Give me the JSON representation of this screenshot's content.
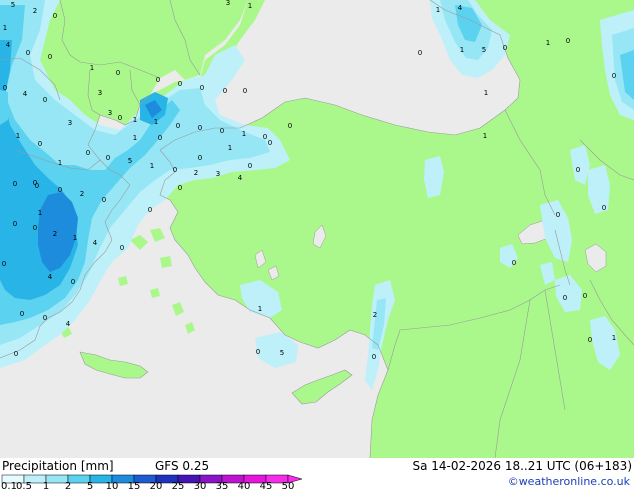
{
  "title": "Precipitation [mm]",
  "model": "GFS 0.25",
  "datetime": "Sa 14-02-2026 18..21 UTC (06+183)",
  "credit": "©weatheronline.co.uk",
  "colors": {
    "land": "#aaf88c",
    "sea": "#ebebeb",
    "border": "#9a9a9a"
  },
  "legend": {
    "ticks": [
      "0.1",
      "0.5",
      "1",
      "2",
      "5",
      "10",
      "15",
      "20",
      "25",
      "30",
      "35",
      "40",
      "45",
      "50"
    ],
    "colors": [
      "#e6fbfd",
      "#bef0fa",
      "#96e6f6",
      "#5ad2f0",
      "#28b4e6",
      "#1e8cdc",
      "#1e5ad2",
      "#1e32be",
      "#4614b4",
      "#8c14c8",
      "#be14d2",
      "#e614dc",
      "#f52deb"
    ]
  },
  "map_labels": [
    "5",
    "2",
    "0",
    "1",
    "3",
    "1",
    "1",
    "4",
    "4",
    "0",
    "0",
    "1",
    "0",
    "0",
    "0",
    "0",
    "0",
    "0",
    "0",
    "1",
    "5",
    "0",
    "1",
    "0",
    "0",
    "0",
    "4",
    "0",
    "3",
    "1",
    "1",
    "0",
    "0",
    "0",
    "1",
    "0",
    "1",
    "0",
    "0",
    "0",
    "5",
    "1",
    "0",
    "2",
    "3",
    "4",
    "0",
    "0",
    "0",
    "2",
    "0",
    "1",
    "1",
    "0",
    "0",
    "0",
    "0",
    "2",
    "1",
    "4",
    "0",
    "0",
    "4",
    "0",
    "0",
    "0",
    "0",
    "0",
    "1",
    "2",
    "0",
    "0",
    "4",
    "0",
    "5",
    "0",
    "0",
    "1",
    "0",
    "0",
    "3",
    "0",
    "1",
    "3",
    "1",
    "1",
    "0",
    "0",
    "0",
    "0",
    "1",
    "0",
    "0",
    "0"
  ]
}
